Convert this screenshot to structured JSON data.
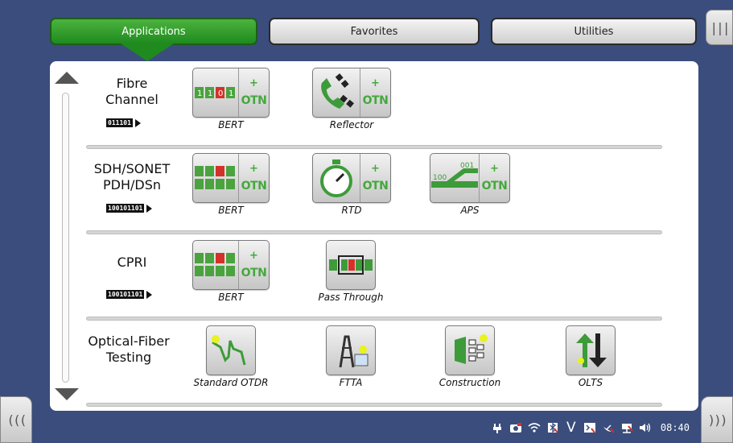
{
  "tabs": [
    {
      "label": "Applications",
      "active": true
    },
    {
      "label": "Favorites",
      "active": false
    },
    {
      "label": "Utilities",
      "active": false
    }
  ],
  "side_buttons": {
    "top_right": "|||",
    "bottom_left": "(((",
    "bottom_right": ")))"
  },
  "sections": [
    {
      "title_line1": "Fibre",
      "title_line2": "Channel",
      "bits": "011101",
      "apps": [
        {
          "label": "BERT",
          "icon": "bert-otn-icon"
        },
        {
          "label": "Reflector",
          "icon": "reflector-otn-icon"
        }
      ]
    },
    {
      "title_line1": "SDH/SONET",
      "title_line2": "PDH/DSn",
      "bits": "100101101",
      "apps": [
        {
          "label": "BERT",
          "icon": "bert-otn-icon"
        },
        {
          "label": "RTD",
          "icon": "stopwatch-otn-icon"
        },
        {
          "label": "APS",
          "icon": "aps-otn-icon"
        }
      ]
    },
    {
      "title_line1": "CPRI",
      "title_line2": "",
      "bits": "100101101",
      "apps": [
        {
          "label": "BERT",
          "icon": "bert-otn-icon"
        },
        {
          "label": "Pass Through",
          "icon": "pass-through-icon"
        }
      ]
    },
    {
      "title_line1": "Optical-Fiber",
      "title_line2": "Testing",
      "bits": "",
      "apps": [
        {
          "label": "Standard OTDR",
          "icon": "otdr-icon"
        },
        {
          "label": "FTTA",
          "icon": "antenna-tower-icon"
        },
        {
          "label": "Construction",
          "icon": "construction-icon"
        },
        {
          "label": "OLTS",
          "icon": "olts-arrows-icon"
        }
      ]
    }
  ],
  "icon_text": {
    "otn": "OTN",
    "plus": "+",
    "bert_top": "1101",
    "bert_bottom": "1011",
    "aps_a": "001",
    "aps_b": "100",
    "pass": "101"
  },
  "status_bar": {
    "time": "08:40",
    "v_label": "V"
  },
  "colors": {
    "background": "#3a4d7c",
    "active_tab": "#1f8a1e",
    "otn_green": "#44a83c"
  }
}
